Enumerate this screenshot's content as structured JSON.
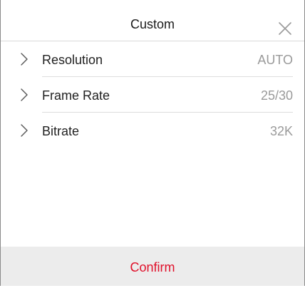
{
  "dialog": {
    "title": "Custom",
    "close_icon": "close-icon",
    "confirm_label": "Confirm",
    "accent_color": "#e0102a"
  },
  "settings": [
    {
      "label": "Resolution",
      "value": "AUTO",
      "icon": "chevron-right-icon"
    },
    {
      "label": "Frame Rate",
      "value": "25/30",
      "icon": "chevron-right-icon"
    },
    {
      "label": "Bitrate",
      "value": "32K",
      "icon": "chevron-right-icon"
    }
  ]
}
